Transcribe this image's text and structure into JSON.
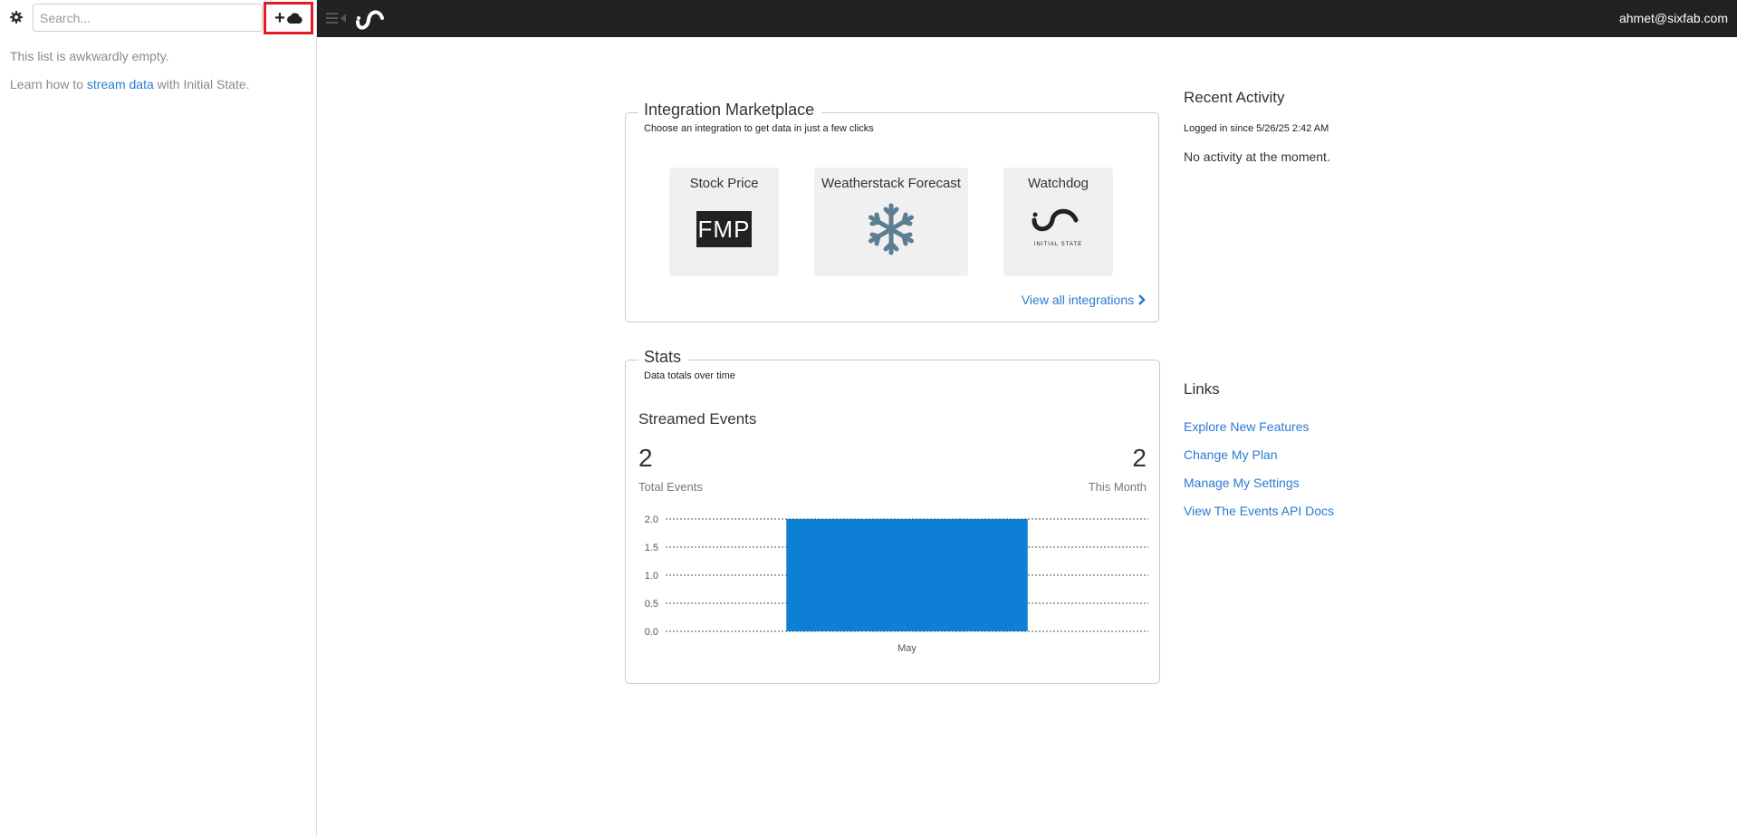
{
  "sidebar": {
    "search_placeholder": "Search...",
    "add_button_plus": "+",
    "empty_message": "This list is awkwardly empty.",
    "learn_prefix": "Learn how to",
    "learn_link": "stream data",
    "learn_suffix": "with Initial State."
  },
  "header": {
    "user_email": "ahmet@sixfab.com"
  },
  "marketplace": {
    "title": "Integration Marketplace",
    "subtitle": "Choose an integration to get data in just a few clicks",
    "cards": [
      {
        "label": "Stock Price",
        "logo_text": "FMP",
        "icon": "fmp-logo"
      },
      {
        "label": "Weatherstack Forecast",
        "icon": "snowflake-icon"
      },
      {
        "label": "Watchdog",
        "logo_text": "INITIAL STATE",
        "icon": "initial-state-logo"
      }
    ],
    "view_all": "View all integrations"
  },
  "stats": {
    "title": "Stats",
    "subtitle": "Data totals over time",
    "streamed_title": "Streamed Events",
    "total_value": "2",
    "total_label": "Total Events",
    "month_value": "2",
    "month_label": "This Month"
  },
  "chart_data": {
    "type": "bar",
    "categories": [
      "May"
    ],
    "values": [
      2
    ],
    "ylim": [
      0,
      2
    ],
    "yticks": [
      "0.0",
      "0.5",
      "1.0",
      "1.5",
      "2.0"
    ],
    "grid": true,
    "bar_color": "#0d80d6"
  },
  "recent": {
    "title": "Recent Activity",
    "logged_in": "Logged in since 5/26/25 2:42 AM",
    "no_activity": "No activity at the moment."
  },
  "links": {
    "title": "Links",
    "items": [
      {
        "label": "Explore New Features"
      },
      {
        "label": "Change My Plan"
      },
      {
        "label": "Manage My Settings"
      },
      {
        "label": "View The Events API Docs"
      }
    ]
  },
  "colors": {
    "accent": "#2a7bd1",
    "topbar": "#222222",
    "highlight_border": "#e11b22"
  }
}
